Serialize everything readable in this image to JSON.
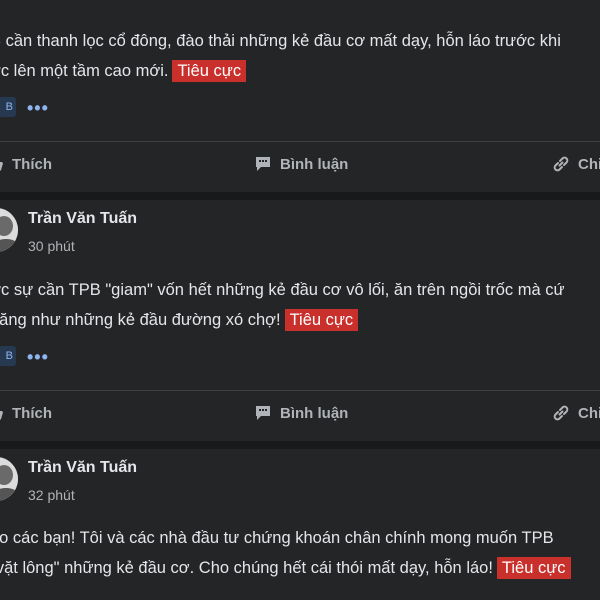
{
  "posts": [
    {
      "text_lines": [
        "B cần thanh lọc cổ đông, đào thải những kẻ đầu cơ mất dạy, hỗn láo trước khi",
        "ớc lên một tầm cao mới."
      ],
      "tag": "Tiêu cực",
      "chip": "B",
      "more": "•••"
    },
    {
      "author": "Trần Văn Tuấn",
      "time": "30 phút",
      "text_lines": [
        "ực sự cần TPB \"giam\" vốn hết những kẻ đầu cơ vô lối, ăn trên ngồi trốc mà cứ",
        "năng như những kẻ đầu đường xó chợ!"
      ],
      "tag": "Tiêu cực",
      "chip": "B",
      "more": "•••"
    },
    {
      "author": "Trần Văn Tuấn",
      "time": "32 phút",
      "text_lines": [
        "ao các bạn! Tôi và các nhà đầu tư chứng khoán chân chính mong muốn TPB",
        "\"vặt lông\" những kẻ đầu cơ. Cho chúng hết cái thói mất dạy, hỗn láo!"
      ],
      "tag": "Tiêu cực"
    }
  ],
  "actions": {
    "like": "Thích",
    "comment": "Bình luận",
    "share": "Chi"
  }
}
